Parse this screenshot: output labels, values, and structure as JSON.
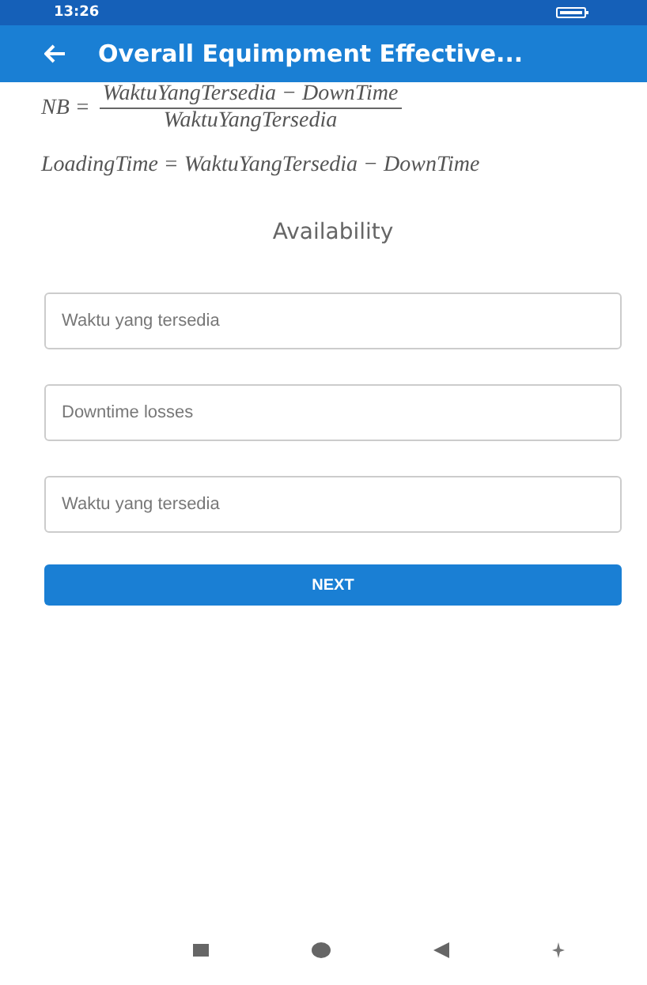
{
  "status_bar": {
    "time": "13:26"
  },
  "app_bar": {
    "title": "Overall Equimpment Effective..."
  },
  "formulas": [
    {
      "kind": "fraction",
      "lhs": "NB =",
      "numerator": "WaktuYangTersedia − DownTime",
      "denominator": "WaktuYangTersedia"
    },
    {
      "kind": "line",
      "text": "LoadingTime = WaktuYangTersedia − DownTime"
    }
  ],
  "section_title": "Availability",
  "fields": [
    {
      "placeholder": "Waktu yang tersedia"
    },
    {
      "placeholder": "Downtime losses"
    },
    {
      "placeholder": "Waktu yang tersedia"
    }
  ],
  "button": "NEXT"
}
